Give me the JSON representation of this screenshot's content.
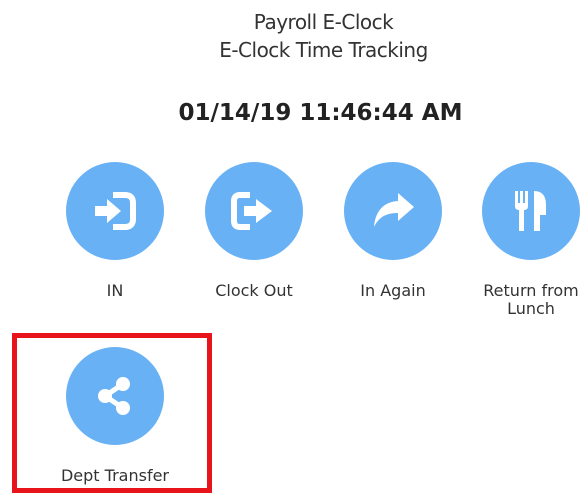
{
  "header": {
    "title": "Payroll E-Clock",
    "subtitle": "E-Clock Time Tracking"
  },
  "clock": {
    "datetime": "01/14/19 11:46:44 AM"
  },
  "actions": [
    {
      "label": "IN",
      "icon": "sign-in-icon"
    },
    {
      "label": "Clock Out",
      "icon": "sign-out-icon"
    },
    {
      "label": "In Again",
      "icon": "share-arrow-icon"
    },
    {
      "label": "Return from Lunch",
      "icon": "fork-knife-icon"
    },
    {
      "label": "Dept Transfer",
      "icon": "share-nodes-icon"
    }
  ],
  "colors": {
    "button": "#68b1f5",
    "highlight": "#e8141c"
  }
}
